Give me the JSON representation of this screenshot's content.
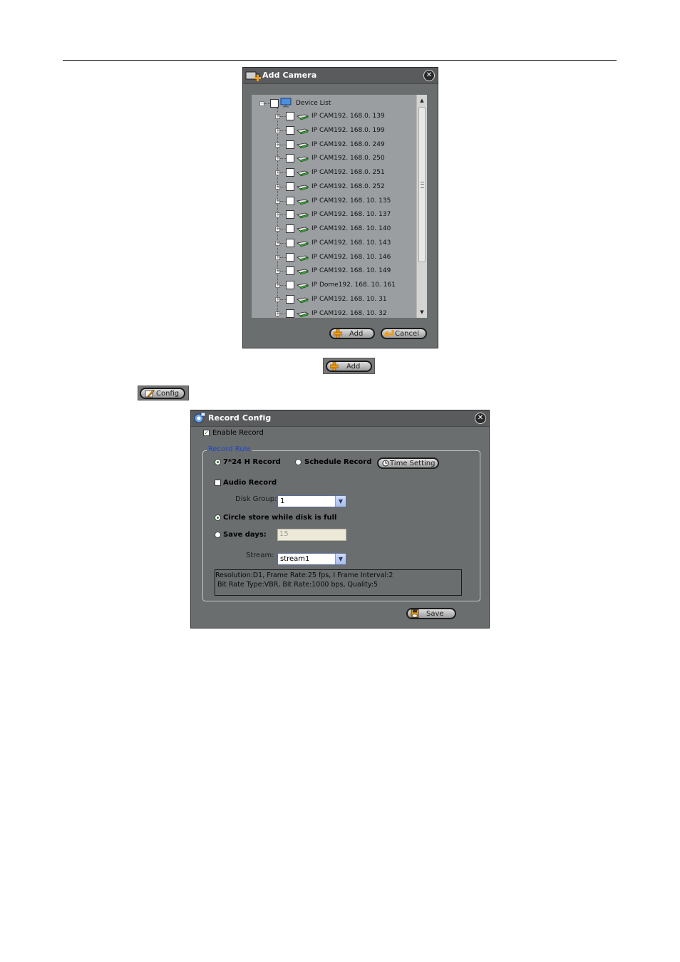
{
  "add_camera": {
    "title": "Add Camera",
    "close_symbol": "✕",
    "tree_root": "Device List",
    "devices": [
      "IP CAM192. 168.0. 139",
      "IP CAM192. 168.0. 199",
      "IP CAM192. 168.0. 249",
      "IP CAM192. 168.0. 250",
      "IP CAM192. 168.0. 251",
      "IP CAM192. 168.0. 252",
      "IP CAM192. 168. 10. 135",
      "IP CAM192. 168. 10. 137",
      "IP CAM192. 168. 10. 140",
      "IP CAM192. 168. 10. 143",
      "IP CAM192. 168. 10. 146",
      "IP CAM192. 168. 10. 149",
      "IP Dome192. 168. 10. 161",
      "IP CAM192. 168. 10. 31",
      "IP CAM192. 168. 10. 32"
    ],
    "add_label": "Add",
    "cancel_label": "Cancel"
  },
  "standalone_buttons": {
    "add_label": "Add",
    "config_label": "Config"
  },
  "record_config": {
    "title": "Record Config",
    "close_symbol": "✕",
    "enable_record_label": "Enable Record",
    "enable_record_checked": true,
    "record_rule_legend": "Record Rule",
    "mode_24h_label": "7*24 H Record",
    "mode_schedule_label": "Schedule Record",
    "selected_mode": "7*24 H Record",
    "time_setting_label": "Time Setting",
    "audio_record_label": "Audio Record",
    "audio_record_checked": false,
    "disk_group_label": "Disk Group:",
    "disk_group_value": "1",
    "circle_store_label": "Circle store while disk is full",
    "save_days_label": "Save days:",
    "save_days_value": "15",
    "storage_selected": "Circle store while disk is full",
    "stream_label": "Stream:",
    "stream_value": "stream1",
    "info_line1": "Resolution:D1, Frame Rate:25 fps, I Frame Interval:2",
    "info_line2": "Bit Rate Type:VBR, Bit Rate:1000 bps, Quality:5",
    "save_label": "Save"
  },
  "colors": {
    "dialog_body": "#6b6e6f",
    "titlebar": "#595b5c",
    "tree_background": "#9a9ea0",
    "legend_blue": "#1d45c8",
    "check_green": "#1a7a1a"
  },
  "icons": [
    "add-camera-icon",
    "monitor-icon",
    "camera-icon",
    "plus-icon",
    "return-icon",
    "pencil-icon",
    "record-config-icon",
    "clock-icon",
    "save-icon",
    "close-icon",
    "chevron-down-icon"
  ]
}
